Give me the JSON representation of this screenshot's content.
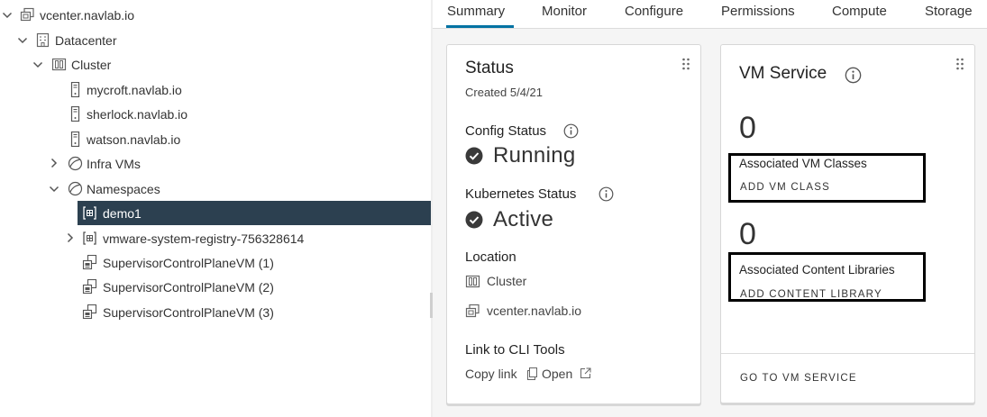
{
  "tree": {
    "items": [
      {
        "label": "vcenter.navlab.io",
        "icon": "vcenter-icon",
        "caret": "down"
      },
      {
        "label": "Datacenter",
        "icon": "datacenter-icon",
        "caret": "down"
      },
      {
        "label": "Cluster",
        "icon": "cluster-icon",
        "caret": "down"
      },
      {
        "label": "mycroft.navlab.io",
        "icon": "host-icon",
        "caret": "none"
      },
      {
        "label": "sherlock.navlab.io",
        "icon": "host-icon",
        "caret": "none"
      },
      {
        "label": "watson.navlab.io",
        "icon": "host-icon",
        "caret": "none"
      },
      {
        "label": "Infra VMs",
        "icon": "resource-pool-icon",
        "caret": "right"
      },
      {
        "label": "Namespaces",
        "icon": "resource-pool-icon",
        "caret": "down"
      },
      {
        "label": "demo1",
        "icon": "namespace-icon",
        "caret": "none",
        "selected": true
      },
      {
        "label": "vmware-system-registry-756328614",
        "icon": "namespace-icon",
        "caret": "right"
      },
      {
        "label": "SupervisorControlPlaneVM (1)",
        "icon": "vm-icon",
        "caret": "none"
      },
      {
        "label": "SupervisorControlPlaneVM (2)",
        "icon": "vm-icon",
        "caret": "none"
      },
      {
        "label": "SupervisorControlPlaneVM (3)",
        "icon": "vm-icon",
        "caret": "none"
      }
    ]
  },
  "tabs": [
    {
      "label": "Summary",
      "active": true
    },
    {
      "label": "Monitor"
    },
    {
      "label": "Configure"
    },
    {
      "label": "Permissions"
    },
    {
      "label": "Compute"
    },
    {
      "label": "Storage"
    }
  ],
  "status_card": {
    "title": "Status",
    "created": "Created 5/4/21",
    "config_status_label": "Config Status",
    "config_status_value": "Running",
    "k8s_status_label": "Kubernetes Status",
    "k8s_status_value": "Active",
    "location_label": "Location",
    "location_cluster": "Cluster",
    "location_vcenter": "vcenter.navlab.io",
    "cli_label": "Link to CLI Tools",
    "copy_link": "Copy link",
    "open_link": "Open"
  },
  "vm_service_card": {
    "title": "VM Service",
    "vm_classes_count": "0",
    "vm_classes_label": "Associated VM Classes",
    "add_vm_class": "ADD VM CLASS",
    "content_libraries_count": "0",
    "content_libraries_label": "Associated Content Libraries",
    "add_content_library": "ADD CONTENT LIBRARY",
    "go_to_vm_service": "GO TO VM SERVICE"
  },
  "colors": {
    "selected_row": "#2c4050",
    "tab_underline": "#0072a3",
    "check": "#3a3a3a"
  }
}
